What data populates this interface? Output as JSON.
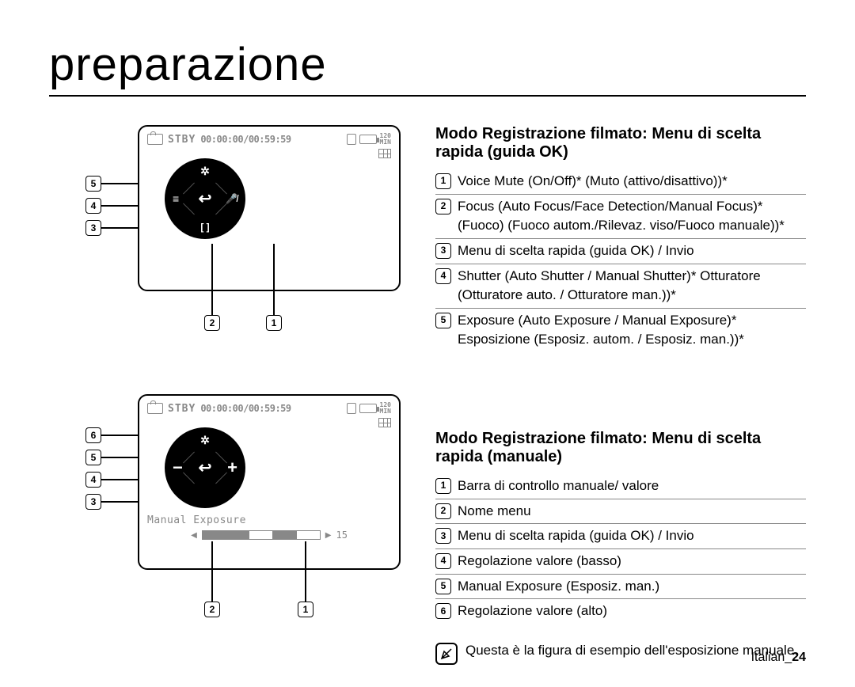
{
  "page_title": "preparazione",
  "status": {
    "stby": "STBY",
    "timecode": "00:00:00/00:59:59",
    "min_label": "120\nMIN"
  },
  "dial1": {
    "top_icon": "aperture",
    "left_icon": "sliders",
    "right_icon": "mic-mute",
    "bottom_icon": "focus-brackets",
    "center_icon": "return"
  },
  "diagram1_callouts_left": [
    "5",
    "4",
    "3"
  ],
  "diagram1_callouts_bottom": [
    "2",
    "1"
  ],
  "diagram2": {
    "manual_label": "Manual Exposure",
    "value": "15"
  },
  "diagram2_callouts_left": [
    "6",
    "5",
    "4",
    "3"
  ],
  "diagram2_callouts_bottom": [
    "2",
    "1"
  ],
  "section1": {
    "title": "Modo Registrazione filmato: Menu di scelta rapida (guida OK)",
    "items": [
      {
        "n": "1",
        "text": "Voice Mute (On/Off)* (Muto (attivo/disattivo))*"
      },
      {
        "n": "2",
        "text": "Focus (Auto Focus/Face Detection/Manual Focus)* (Fuoco) (Fuoco autom./Rilevaz. viso/Fuoco manuale))*"
      },
      {
        "n": "3",
        "text": "Menu di scelta rapida (guida OK) / Invio"
      },
      {
        "n": "4",
        "text": "Shutter (Auto Shutter / Manual Shutter)* Otturatore (Otturatore auto. / Otturatore man.))*"
      },
      {
        "n": "5",
        "text": "Exposure (Auto Exposure / Manual Exposure)* Esposizione (Esposiz. autom. / Esposiz. man.))*"
      }
    ]
  },
  "section2": {
    "title": "Modo Registrazione filmato: Menu di scelta rapida (manuale)",
    "items": [
      {
        "n": "1",
        "text": "Barra di controllo manuale/ valore"
      },
      {
        "n": "2",
        "text": "Nome menu"
      },
      {
        "n": "3",
        "text": "Menu di scelta rapida (guida OK) / Invio"
      },
      {
        "n": "4",
        "text": "Regolazione valore (basso)"
      },
      {
        "n": "5",
        "text": "Manual Exposure (Esposiz. man.)"
      },
      {
        "n": "6",
        "text": "Regolazione valore (alto)"
      }
    ]
  },
  "note": "Questa è la figura di esempio dell'esposizione manuale.",
  "footer": {
    "lang": "Italian_",
    "page": "24"
  }
}
